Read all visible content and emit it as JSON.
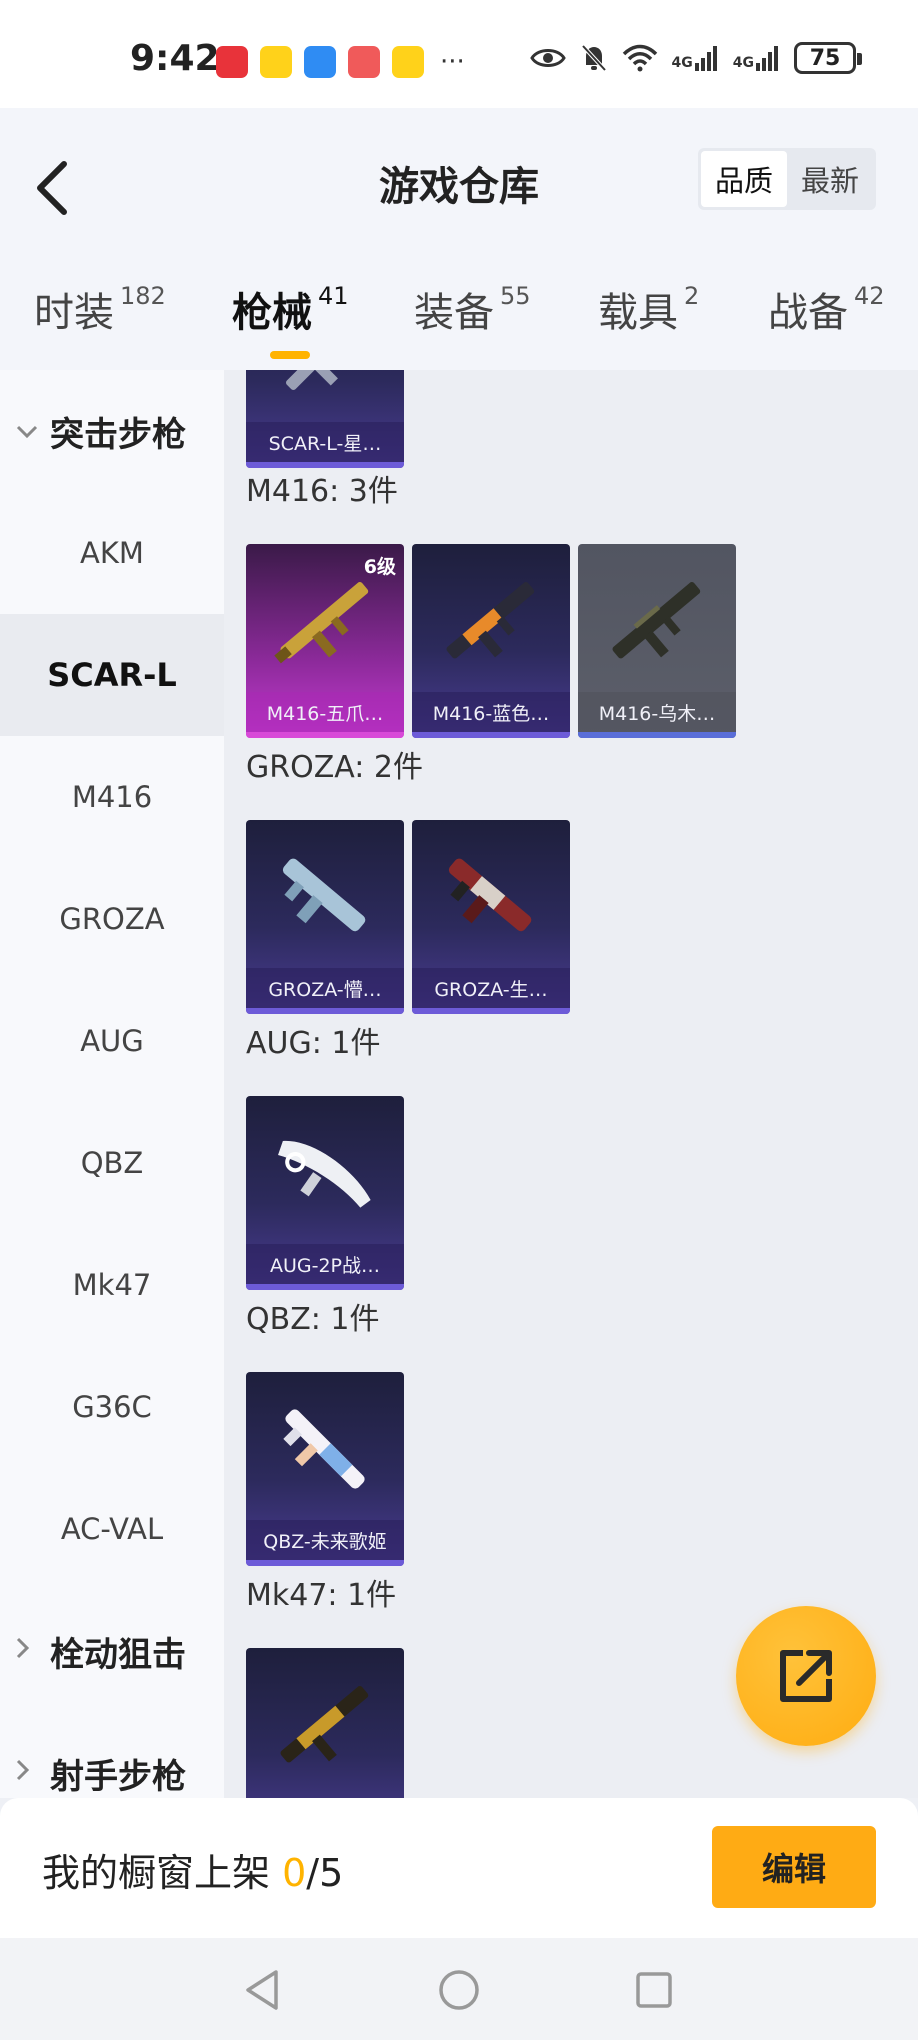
{
  "status_bar": {
    "time": "9:42",
    "battery": "75",
    "network_1": "4G",
    "network_2": "4G",
    "more": "···"
  },
  "header": {
    "title": "游戏仓库",
    "sort_options": [
      "品质",
      "最新"
    ]
  },
  "tabs": [
    {
      "label": "时装",
      "count": "182"
    },
    {
      "label": "枪械",
      "count": "41"
    },
    {
      "label": "装备",
      "count": "55"
    },
    {
      "label": "载具",
      "count": "2"
    },
    {
      "label": "战备",
      "count": "42"
    }
  ],
  "sidebar": {
    "groups": [
      "突击步枪",
      "栓动狙击",
      "射手步枪"
    ],
    "items": [
      "AKM",
      "SCAR-L",
      "M416",
      "GROZA",
      "AUG",
      "QBZ",
      "Mk47",
      "G36C",
      "AC-VAL"
    ]
  },
  "content": {
    "top_card": {
      "name": "SCAR-L-星…"
    },
    "groups": [
      {
        "title": "M416: 3件",
        "items": [
          {
            "name": "M416-五爪…",
            "badge": "6级"
          },
          {
            "name": "M416-蓝色…"
          },
          {
            "name": "M416-乌木…"
          }
        ]
      },
      {
        "title": "GROZA: 2件",
        "items": [
          {
            "name": "GROZA-懵…"
          },
          {
            "name": "GROZA-生…"
          }
        ]
      },
      {
        "title": "AUG: 1件",
        "items": [
          {
            "name": "AUG-2P战…"
          }
        ]
      },
      {
        "title": "QBZ: 1件",
        "items": [
          {
            "name": "QBZ-未来歌姬"
          }
        ]
      },
      {
        "title": "Mk47: 1件",
        "items": [
          {}
        ]
      }
    ]
  },
  "bottom": {
    "shelf_label": "我的橱窗上架 ",
    "shelf_current": "0",
    "shelf_total": "/5",
    "edit_label": "编辑"
  },
  "colors": {
    "accent": "#ffab14",
    "active_tab_underline": "#ffb300"
  }
}
